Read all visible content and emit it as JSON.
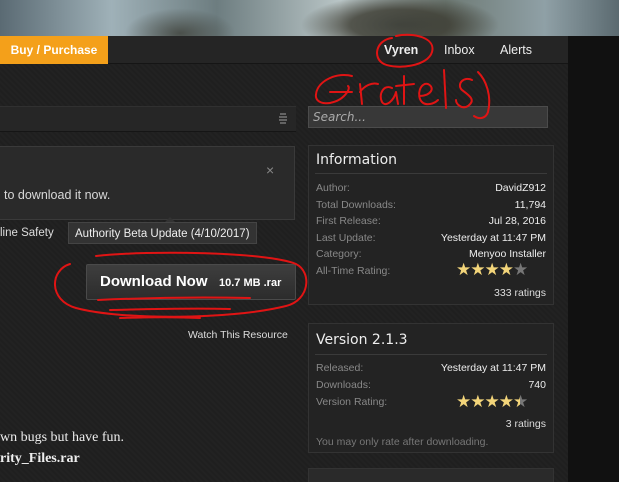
{
  "nav": {
    "buy_label": "Buy / Purchase",
    "user": "Vyren",
    "inbox": "Inbox",
    "alerts": "Alerts"
  },
  "notice": {
    "text": "to download it now.",
    "close": "×"
  },
  "tags": {
    "previous": "line Safety",
    "current": "Authority Beta Update (4/10/2017)"
  },
  "download": {
    "label": "Download Now",
    "size": "10.7 MB .rar",
    "watch": "Watch This Resource"
  },
  "body": {
    "line1": "wn bugs but have fun.",
    "line2": "rity_Files.rar"
  },
  "search": {
    "placeholder": "Search..."
  },
  "information": {
    "title": "Information",
    "rows": [
      {
        "label": "Author:",
        "value": "DavidZ912"
      },
      {
        "label": "Total Downloads:",
        "value": "11,794"
      },
      {
        "label": "First Release:",
        "value": "Jul 28, 2016"
      },
      {
        "label": "Last Update:",
        "value": "Yesterday at 11:47 PM"
      },
      {
        "label": "Category:",
        "value": "Menyoo Installer"
      },
      {
        "label": "All-Time Rating:",
        "value": ""
      }
    ],
    "rating_stars": 4,
    "ratings_count": "333 ratings"
  },
  "version": {
    "title": "Version 2.1.3",
    "rows": [
      {
        "label": "Released:",
        "value": "Yesterday at 11:47 PM"
      },
      {
        "label": "Downloads:",
        "value": "740"
      },
      {
        "label": "Version Rating:",
        "value": ""
      }
    ],
    "rating_stars": 4.5,
    "ratings_count": "3 ratings",
    "note": "You may only rate after downloading."
  },
  "annotation": {
    "text": "Grates",
    "color": "#e01414"
  }
}
